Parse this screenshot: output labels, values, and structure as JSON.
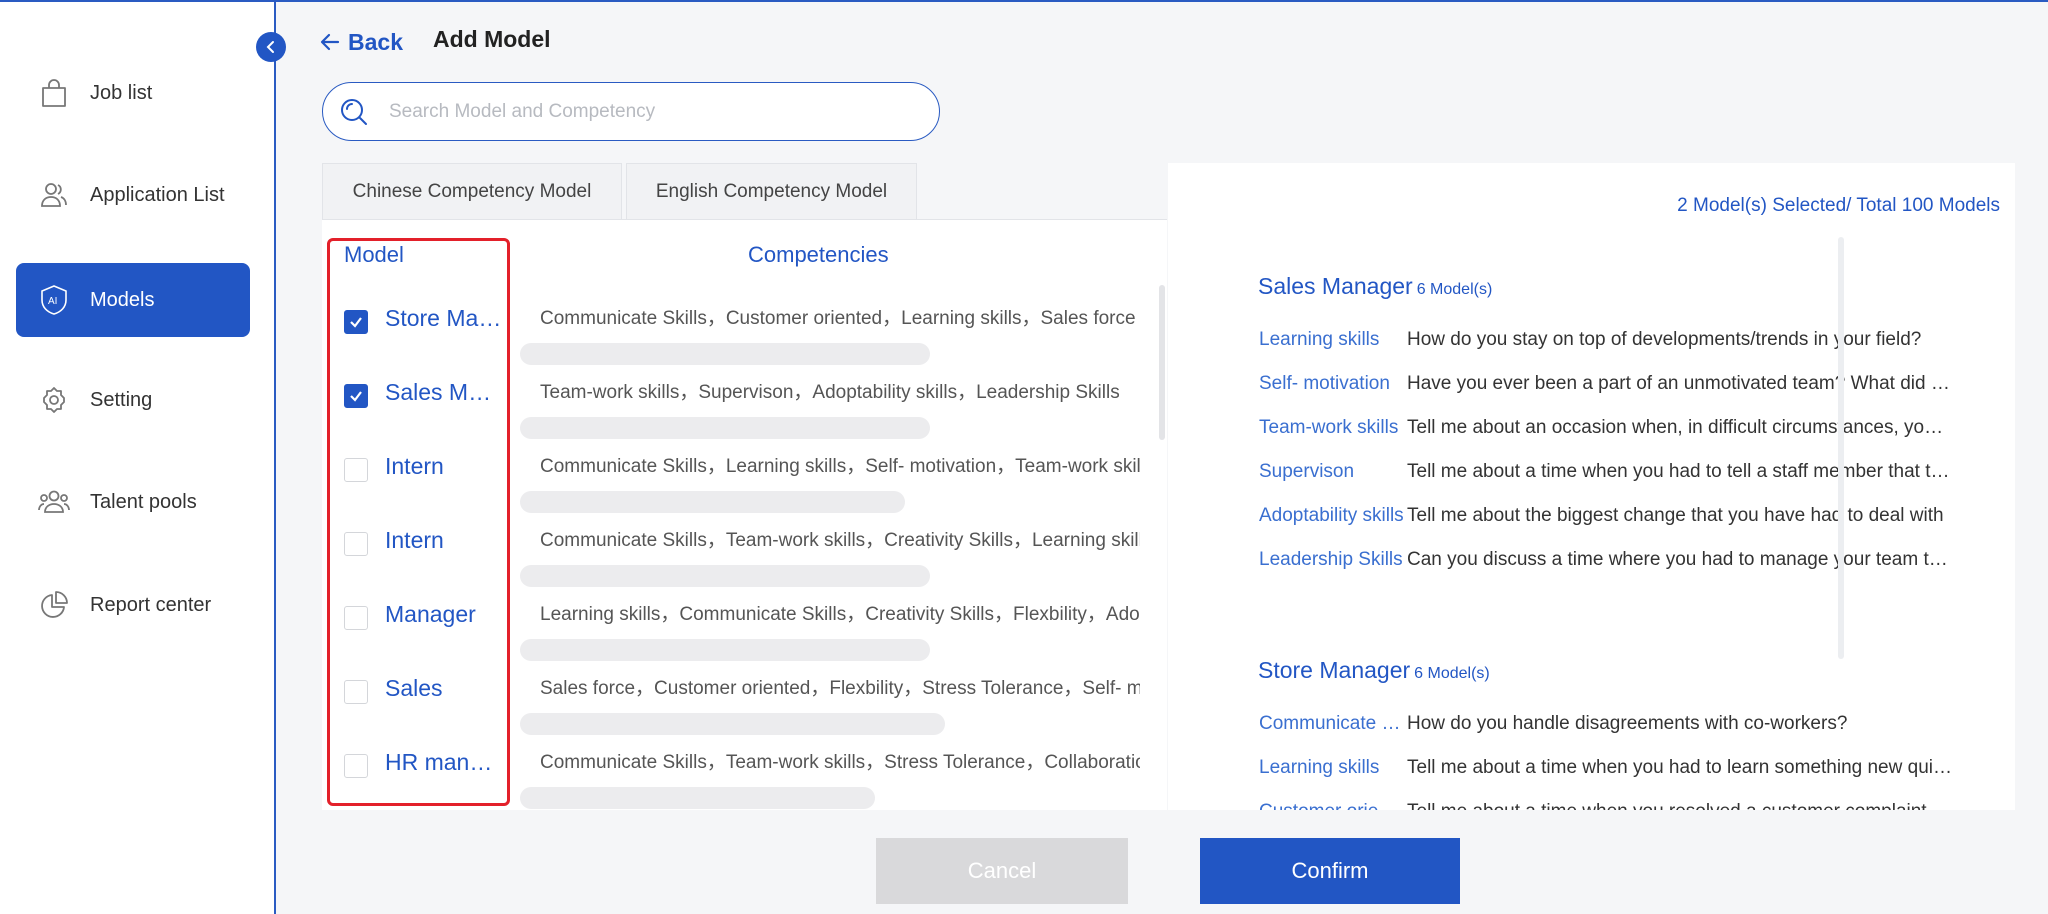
{
  "sidebar": {
    "items": [
      {
        "label": "Job list",
        "icon": "bag-icon"
      },
      {
        "label": "Application List",
        "icon": "users-icon"
      },
      {
        "label": "Models",
        "icon": "ai-shield-icon",
        "active": true
      },
      {
        "label": "Setting",
        "icon": "gear-icon"
      },
      {
        "label": "Talent pools",
        "icon": "group-icon"
      },
      {
        "label": "Report center",
        "icon": "pie-chart-icon"
      }
    ]
  },
  "header": {
    "back_label": "Back",
    "title": "Add Model"
  },
  "search": {
    "placeholder": "Search Model and Competency",
    "value": ""
  },
  "tabs": [
    {
      "label": "Chinese Competency Model"
    },
    {
      "label": "English Competency Model"
    }
  ],
  "model_table": {
    "model_header": "Model",
    "competencies_header": "Competencies",
    "rows": [
      {
        "name": "Store Manager",
        "checked": true,
        "competencies": "Communicate Skills，Customer oriented，Learning skills，Sales force"
      },
      {
        "name": "Sales Manager",
        "checked": true,
        "competencies": "Team-work skills，Supervison，Adoptability skills，Leadership Skills"
      },
      {
        "name": "Intern",
        "checked": false,
        "competencies": "Communicate Skills，Learning skills，Self- motivation，Team-work skills"
      },
      {
        "name": "Intern",
        "checked": false,
        "competencies": "Communicate Skills，Team-work skills，Creativity Skills，Learning skills"
      },
      {
        "name": "Manager",
        "checked": false,
        "competencies": "Learning skills，Communicate Skills，Creativity Skills，Flexbility，Adoptability"
      },
      {
        "name": "Sales",
        "checked": false,
        "competencies": "Sales force，Customer oriented，Flexbility，Stress Tolerance，Self- motivation"
      },
      {
        "name": "HR manager",
        "checked": false,
        "competencies": "Communicate Skills，Team-work skills，Stress Tolerance，Collaboration"
      }
    ]
  },
  "selection": {
    "summary": "2 Model(s) Selected/ Total 100 Models",
    "groups": [
      {
        "title": "Sales Manager",
        "count": "6 Model(s)",
        "items": [
          {
            "competency": "Learning skills",
            "question": "How do you stay on top of developments/trends in your field?"
          },
          {
            "competency": "Self- motivation",
            "question": "Have you ever been a part of an unmotivated team? What did you do?"
          },
          {
            "competency": "Team-work skills",
            "question": "Tell me about an occasion when, in difficult circumstances, you worked in a team"
          },
          {
            "competency": "Supervison",
            "question": "Tell me about a time when you had to tell a staff member that their work was poor"
          },
          {
            "competency": "Adoptability skills",
            "question": "Tell me about the biggest change that you have had to deal with"
          },
          {
            "competency": "Leadership Skills",
            "question": "Can you discuss a time where you had to manage your team through a crisis"
          }
        ]
      },
      {
        "title": "Store Manager",
        "count": "6 Model(s)",
        "items": [
          {
            "competency": "Communicate Skills",
            "question": "How do you handle disagreements with co-workers?"
          },
          {
            "competency": "Learning skills",
            "question": "Tell me about a time when you had to learn something new quickly"
          },
          {
            "competency": "Customer oriented",
            "question": "Tell me about a time when you resolved a customer complaint"
          }
        ]
      }
    ]
  },
  "buttons": {
    "cancel": "Cancel",
    "confirm": "Confirm"
  },
  "colors": {
    "primary": "#2256c4",
    "highlight_box": "#e3202a",
    "cancel_bg": "#d9d9db"
  }
}
